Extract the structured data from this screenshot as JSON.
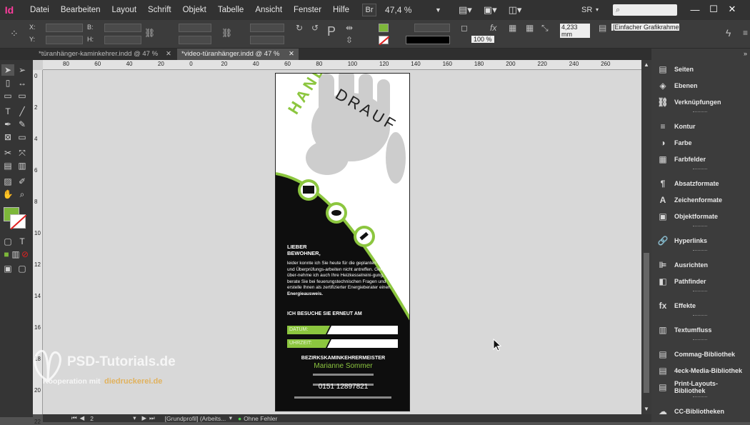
{
  "app": {
    "logo": "Id"
  },
  "menu": [
    "Datei",
    "Bearbeiten",
    "Layout",
    "Schrift",
    "Objekt",
    "Tabelle",
    "Ansicht",
    "Fenster",
    "Hilfe"
  ],
  "toolbar_top": {
    "br_label": "Br",
    "zoom": "47,4 %",
    "workspace": "SR",
    "search_placeholder": ""
  },
  "window": {
    "minimize": "—",
    "maximize": "☐",
    "close": "✕"
  },
  "control": {
    "x_label": "X:",
    "y_label": "Y:",
    "b_label": "B:",
    "h_label": "H:",
    "stroke_weight": "4,233 mm",
    "scale": "100 %",
    "object_style": "[Einfacher Grafikrahmen]+"
  },
  "tabs": [
    {
      "label": "*türanhänger-kaminkehrer.indd @ 47 %",
      "active": false
    },
    {
      "label": "*video-türanhänger.indd @ 47 %",
      "active": true
    }
  ],
  "ruler_h": [
    "80",
    "60",
    "40",
    "20",
    "0",
    "20",
    "40",
    "60",
    "80",
    "100",
    "120",
    "140",
    "160",
    "180",
    "200",
    "220",
    "240",
    "260"
  ],
  "ruler_v": [
    "0",
    "2",
    "4",
    "6",
    "8",
    "10",
    "12",
    "14",
    "16",
    "18",
    "20",
    "22"
  ],
  "panels": [
    {
      "name": "Seiten",
      "icon": "pages-icon"
    },
    {
      "name": "Ebenen",
      "icon": "layers-icon"
    },
    {
      "name": "Verknüpfungen",
      "icon": "links-icon"
    },
    {
      "name": "Kontur",
      "icon": "stroke-icon"
    },
    {
      "name": "Farbe",
      "icon": "color-icon"
    },
    {
      "name": "Farbfelder",
      "icon": "swatches-icon"
    },
    {
      "name": "Absatzformate",
      "icon": "paragraph-styles-icon"
    },
    {
      "name": "Zeichenformate",
      "icon": "character-styles-icon"
    },
    {
      "name": "Objektformate",
      "icon": "object-styles-icon"
    },
    {
      "name": "Hyperlinks",
      "icon": "hyperlinks-icon"
    },
    {
      "name": "Ausrichten",
      "icon": "align-icon"
    },
    {
      "name": "Pathfinder",
      "icon": "pathfinder-icon"
    },
    {
      "name": "Effekte",
      "icon": "effects-icon"
    },
    {
      "name": "Textumfluss",
      "icon": "text-wrap-icon"
    },
    {
      "name": "Commag-Bibliothek",
      "icon": "library-icon"
    },
    {
      "name": "4eck-Media-Bibliothek",
      "icon": "library-icon"
    },
    {
      "name": "Print-Layouts-Bibliothek",
      "icon": "library-icon"
    },
    {
      "name": "CC-Bibliotheken",
      "icon": "cc-libraries-icon"
    }
  ],
  "status": {
    "page": "2",
    "profile": "[Grundprofil] (Arbeits...",
    "errors": "Ohne Fehler"
  },
  "document": {
    "title_hand": "HAND",
    "title_drauf": "DRAUF",
    "greeting": "LIEBER BEWOHNER,",
    "body": "leider konnte ich Sie heute für die geplanten Kehr- und Überprüfungs-arbeiten nicht antreffen. Gerne über-nehme ich auch Ihre Heizkesselreini-gung, berate Sie bei feuerungstechnischen Fragen und erstelle Ihnen als zertifizierter Energieberater einen",
    "body_bold": "Energieausweis.",
    "revisit": "ICH BESUCHE SIE ERNEUT AM",
    "date_label": "DATUM:",
    "time_label": "UHRZEIT:",
    "role": "BEZIRKSKAMINKEHRERMEISTER",
    "name": "Marianne Sommer",
    "phone": "0151 12897821",
    "accent": "#8cc63f"
  },
  "watermark": {
    "title": "PSD-Tutorials.de",
    "sub": "Kooperation mit",
    "partner": "diedruckerei.de"
  },
  "colors": {
    "fill_swatch": "#7db73a",
    "accent": "#8cc63f"
  }
}
